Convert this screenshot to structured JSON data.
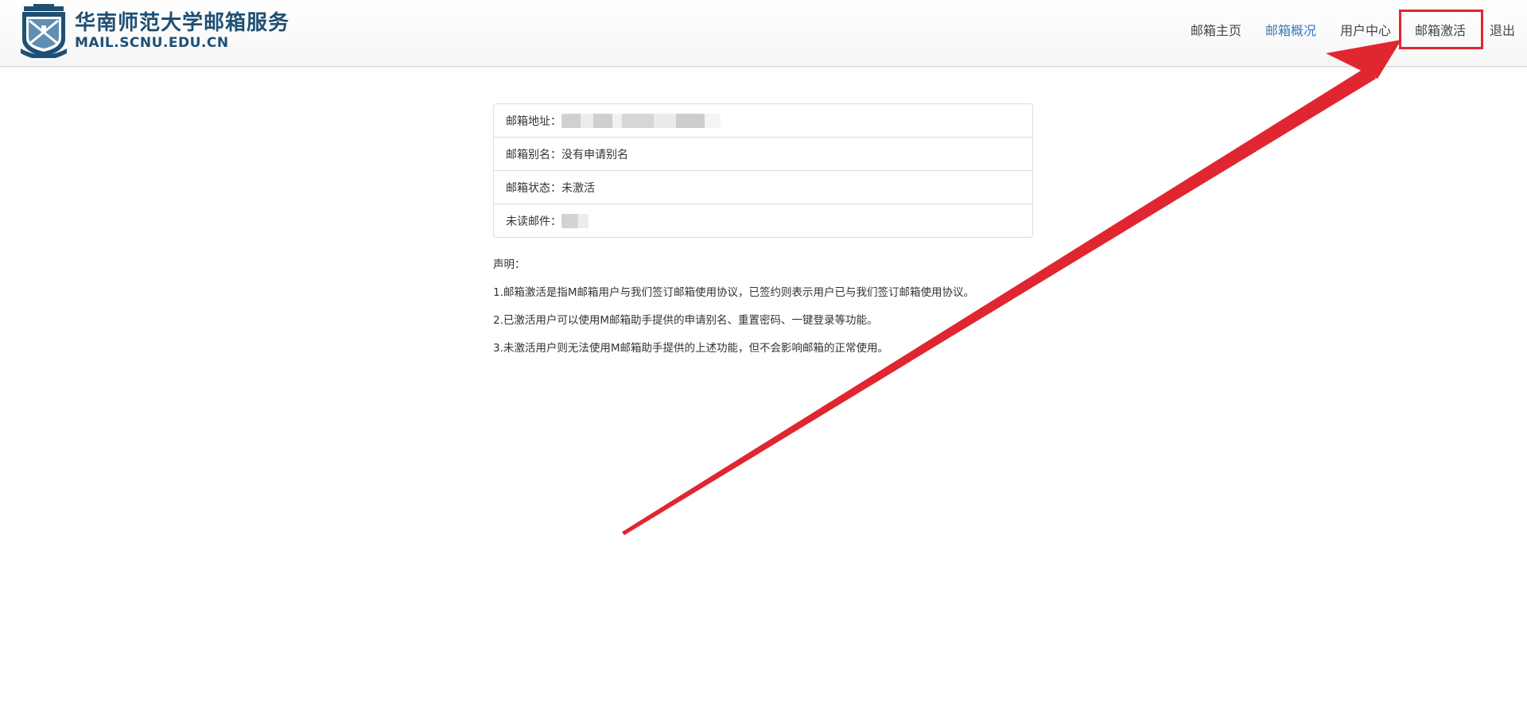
{
  "header": {
    "brand_title": "华南师范大学邮箱服务",
    "brand_subtitle": "MAIL.SCNU.EDU.CN",
    "nav_items": [
      {
        "label": "邮箱主页"
      },
      {
        "label": "邮箱概况"
      },
      {
        "label": "用户中心"
      },
      {
        "label": "邮箱激活"
      },
      {
        "label": "退出"
      }
    ]
  },
  "info": {
    "address_label": "邮箱地址：",
    "alias_label": "邮箱别名：",
    "alias_value": "没有申请别名",
    "status_label": "邮箱状态：",
    "status_value": "未激活",
    "unread_label": "未读邮件："
  },
  "statement": {
    "heading": "声明：",
    "items": [
      "1.邮箱激活是指M邮箱用户与我们签订邮箱使用协议，已签约则表示用户已与我们签订邮箱使用协议。",
      "2.已激活用户可以使用M邮箱助手提供的申请别名、重置密码、一键登录等功能。",
      "3.未激活用户则无法使用M邮箱助手提供的上述功能，但不会影响邮箱的正常使用。"
    ]
  },
  "colors": {
    "active_nav": "#3a7ab8",
    "annotation_red": "#e02630",
    "brand": "#1f4f73"
  },
  "icons": {
    "logo": "university-seal-icon",
    "arrow": "annotation-arrow-icon"
  }
}
